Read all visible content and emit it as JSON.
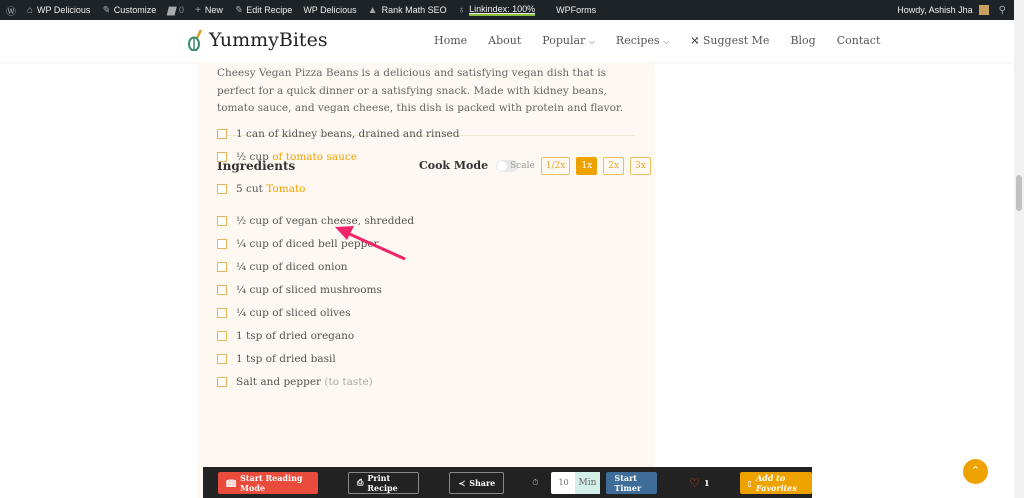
{
  "adminbar": {
    "items": [
      "WP Delicious",
      "Customize",
      "0",
      "New",
      "Edit Recipe",
      "WP Delicious",
      "Rank Math SEO",
      "Linkindex: 100%",
      "WPForms"
    ],
    "howdy": "Howdy, Ashish Jha"
  },
  "header": {
    "logo": "YummyBites",
    "nav": [
      "Home",
      "About",
      "Popular",
      "Recipes",
      "Suggest Me",
      "Blog",
      "Contact"
    ]
  },
  "recipe": {
    "description": "Cheesy Vegan Pizza Beans is a delicious and satisfying vegan dish that is perfect for a quick dinner or a satisfying snack. Made with kidney beans, tomato sauce, and vegan cheese, this dish is packed with protein and flavor.",
    "ingredients_heading": "Ingredients",
    "cook_mode": "Cook Mode",
    "scale_label": "Scale",
    "scales": [
      "1/2x",
      "1x",
      "2x",
      "3x"
    ],
    "active_scale": "1x",
    "ingredients": [
      {
        "qty": "1 can of kidney beans, drained and rinsed",
        "link": "",
        "note": ""
      },
      {
        "qty": "½ cup",
        "link": "of tomato sauce",
        "note": ""
      },
      {
        "qty": "5 cut",
        "link": "Tomato",
        "note": ""
      },
      {
        "qty": "½ cup of vegan cheese, shredded",
        "link": "",
        "note": ""
      },
      {
        "qty": "¼ cup of diced bell pepper",
        "link": "",
        "note": ""
      },
      {
        "qty": "¼ cup of diced onion",
        "link": "",
        "note": ""
      },
      {
        "qty": "¼ cup of sliced mushrooms",
        "link": "",
        "note": ""
      },
      {
        "qty": "¼ cup of sliced olives",
        "link": "",
        "note": ""
      },
      {
        "qty": "1 tsp of dried oregano",
        "link": "",
        "note": ""
      },
      {
        "qty": "1 tsp of dried basil",
        "link": "",
        "note": ""
      },
      {
        "qty": "Salt and pepper",
        "link": "",
        "note": "(to taste)"
      }
    ]
  },
  "actionbar": {
    "reading": "Start Reading Mode",
    "print": "Print Recipe",
    "share": "Share",
    "timer_value": "10",
    "timer_unit": "Min",
    "start_timer": "Start Timer",
    "likes": "1",
    "favorites": "Add to Favorites"
  },
  "colors": {
    "accent": "#eea200",
    "red": "#e94b3c",
    "blue": "#3e6d99"
  }
}
